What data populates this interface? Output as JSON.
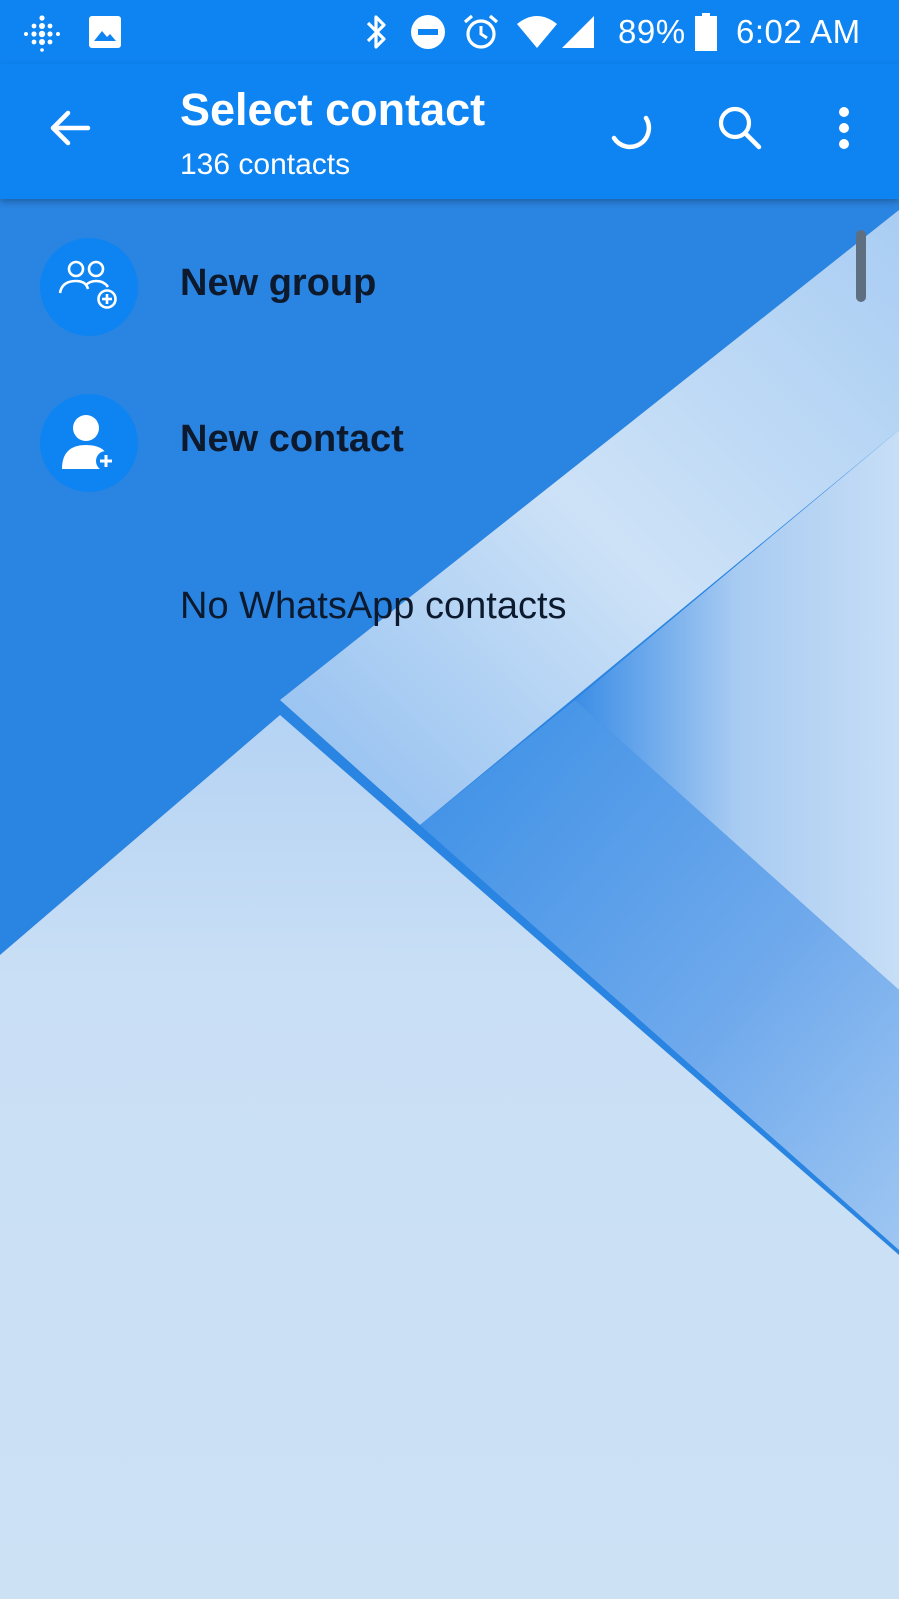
{
  "status_bar": {
    "left_icons": [
      "fitbit-icon",
      "image-icon"
    ],
    "right_icons": [
      "bluetooth-icon",
      "do-not-disturb-icon",
      "alarm-icon",
      "wifi-icon",
      "cell-signal-icon",
      "battery-icon"
    ],
    "battery_percent": "89%",
    "time": "6:02 AM"
  },
  "app_bar": {
    "title": "Select contact",
    "subtitle": "136 contacts",
    "actions": [
      "back-arrow-icon",
      "loading-spinner-icon",
      "search-icon",
      "more-options-icon"
    ]
  },
  "list": {
    "items": [
      {
        "label": "New group",
        "icon": "group-add-icon"
      },
      {
        "label": "New contact",
        "icon": "person-add-icon"
      }
    ],
    "empty_message": "No WhatsApp contacts"
  },
  "colors": {
    "primary": "#0d84f2",
    "background_light": "#c9dff5",
    "background_mid": "#2e86e3",
    "text_dark": "#0d1a2d"
  }
}
